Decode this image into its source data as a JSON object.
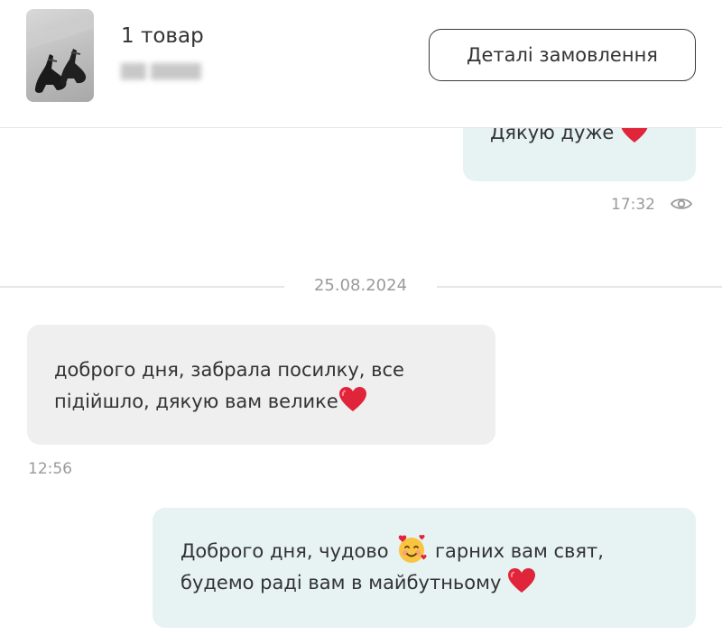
{
  "order": {
    "item_count": "1 товар",
    "details_button": "Деталі замовлення"
  },
  "chat": {
    "messages": [
      {
        "direction": "outgoing",
        "text": "Дякую дуже",
        "emoji_end": "heart-icon",
        "time": "17:32",
        "status_icon": "eye-icon"
      },
      {
        "direction": "incoming",
        "line1": "доброго дня, забрала посилку, все",
        "line2": "підійшло, дякую вам велике",
        "emoji_end": "heart-icon",
        "time": "12:56"
      },
      {
        "direction": "outgoing",
        "line1_before": "Доброго дня, чудово",
        "line1_emoji": "smiling-face-with-hearts-icon",
        "line1_after": "гарних вам свят,",
        "line2": "будемо раді вам в майбутньому",
        "emoji_end": "heart-icon"
      }
    ],
    "date_separator": "25.08.2024"
  },
  "colors": {
    "outgoing_bubble": "#e6f3f2",
    "incoming_bubble": "#efefef",
    "heart": "#e0243a",
    "timestamp": "#9a9a9a"
  }
}
